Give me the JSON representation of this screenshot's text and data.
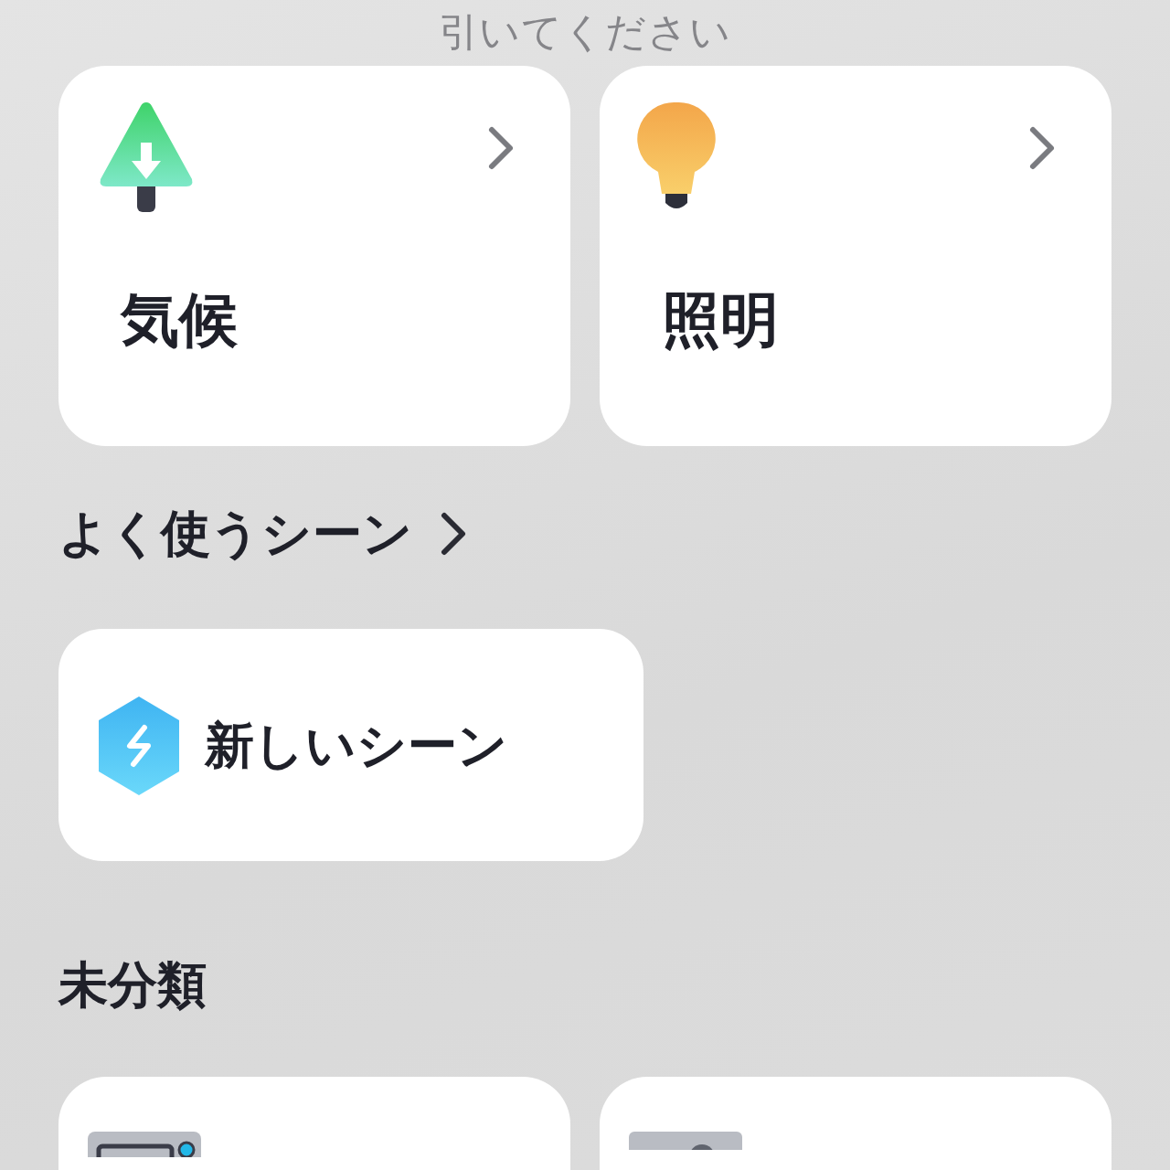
{
  "pull_hint": "引いてください",
  "categories": [
    {
      "kind": "climate",
      "label": "気候"
    },
    {
      "kind": "lighting",
      "label": "照明"
    }
  ],
  "favorites": {
    "title": "よく使うシーン",
    "scenes": [
      {
        "label": "新しいシーン"
      }
    ]
  },
  "uncategorized": {
    "title": "未分類",
    "devices": [
      {
        "kind": "tv"
      },
      {
        "kind": "camera"
      }
    ]
  }
}
